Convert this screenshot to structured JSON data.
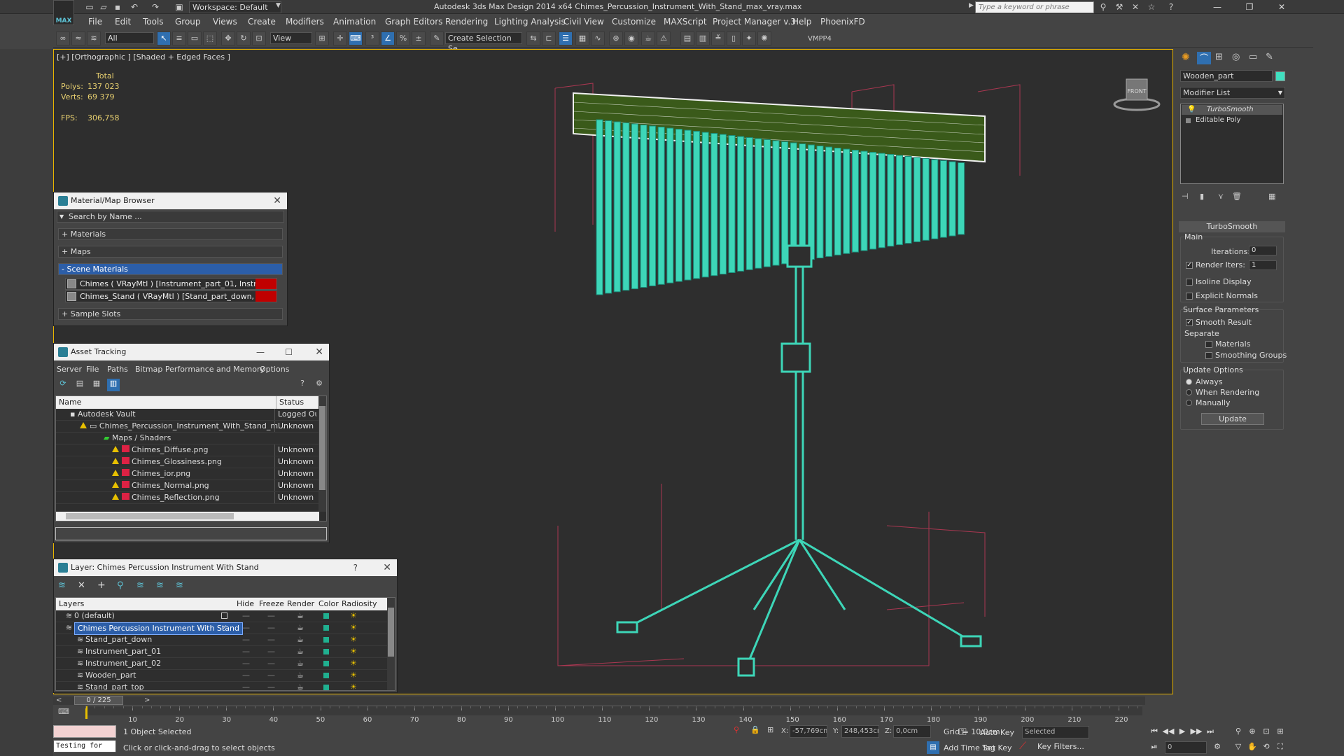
{
  "window": {
    "title": "Autodesk 3ds Max Design 2014 x64     Chimes_Percussion_Instrument_With_Stand_max_vray.max",
    "workspace": "Workspace: Default",
    "search_placeholder": "Type a keyword or phrase",
    "logo": "MAX"
  },
  "menu": [
    "File",
    "Edit",
    "Tools",
    "Group",
    "Views",
    "Create",
    "Modifiers",
    "Animation",
    "Graph Editors",
    "Rendering",
    "Lighting Analysis",
    "Civil View",
    "Customize",
    "MAXScript",
    "Project Manager v.3",
    "Help",
    "PhoenixFD"
  ],
  "toolbar": {
    "selection_filter": "All",
    "ref_coord": "View",
    "named_selection": "Create Selection Se",
    "vmpp": "VMPP4"
  },
  "viewport": {
    "label": "[+] [Orthographic ] [Shaded + Edged Faces ]",
    "stats": {
      "total_label": "Total",
      "polys_label": "Polys:",
      "polys": "137 023",
      "verts_label": "Verts:",
      "verts": "69 379",
      "fps_label": "FPS:",
      "fps": "306,758"
    },
    "viewcube_label": "FRONT"
  },
  "material_browser": {
    "title": "Material/Map Browser",
    "search_placeholder": "Search by Name ...",
    "groups": [
      "+ Materials",
      "+ Maps",
      "- Scene Materials",
      "+ Sample Slots"
    ],
    "materials": [
      "Chimes  ( VRayMtl )  [Instrument_part_01, Instrument_par...",
      "Chimes_Stand  ( VRayMtl ) [Stand_part_down, Stand_part..."
    ]
  },
  "asset_tracking": {
    "title": "Asset Tracking",
    "menu": [
      "Server",
      "File",
      "Paths",
      "Bitmap Performance and Memory",
      "Options"
    ],
    "col_name": "Name",
    "col_status": "Status",
    "rows": [
      {
        "name": "Autodesk Vault",
        "status": "Logged Out"
      },
      {
        "name": "Chimes_Percussion_Instrument_With_Stand_m...",
        "status": "Unknown St"
      },
      {
        "name": "Maps / Shaders",
        "status": ""
      },
      {
        "name": "Chimes_Diffuse.png",
        "status": "Unknown St"
      },
      {
        "name": "Chimes_Glossiness.png",
        "status": "Unknown St"
      },
      {
        "name": "Chimes_ior.png",
        "status": "Unknown St"
      },
      {
        "name": "Chimes_Normal.png",
        "status": "Unknown St"
      },
      {
        "name": "Chimes_Reflection.png",
        "status": "Unknown St"
      }
    ]
  },
  "layer_manager": {
    "title": "Layer: Chimes Percussion Instrument With Stand",
    "help": "?",
    "columns": [
      "Layers",
      "Hide",
      "Freeze",
      "Render",
      "Color",
      "Radiosity"
    ],
    "rows": [
      {
        "name": "0 (default)",
        "color": "#20b090"
      },
      {
        "name": "Chimes Percussion Instrument With Stand",
        "color": "#20b090"
      },
      {
        "name": "Stand_part_down",
        "color": "#20b090"
      },
      {
        "name": "Instrument_part_01",
        "color": "#20b090"
      },
      {
        "name": "Instrument_part_02",
        "color": "#20b090"
      },
      {
        "name": "Wooden_part",
        "color": "#20b090"
      },
      {
        "name": "Stand_part_top",
        "color": "#20b090"
      }
    ]
  },
  "command_panel": {
    "object_name": "Wooden_part",
    "object_color": "#40e0c0",
    "modifier_list": "Modifier List",
    "stack": [
      "TurboSmooth",
      "Editable Poly"
    ],
    "turbosmooth": {
      "title": "TurboSmooth",
      "main": "Main",
      "iterations_label": "Iterations:",
      "iterations": "0",
      "render_iters_label": "Render Iters:",
      "render_iters": "1",
      "isoline": "Isoline Display",
      "explicit": "Explicit Normals",
      "surface": "Surface Parameters",
      "smooth_result": "Smooth Result",
      "separate": "Separate",
      "materials": "Materials",
      "smoothing_groups": "Smoothing Groups",
      "update_options": "Update Options",
      "always": "Always",
      "when_rendering": "When Rendering",
      "manually": "Manually",
      "update": "Update"
    }
  },
  "timeline": {
    "frame": "0 / 225",
    "ticks": [
      "10",
      "20",
      "30",
      "40",
      "50",
      "60",
      "70",
      "80",
      "90",
      "100",
      "110",
      "120",
      "130",
      "140",
      "150",
      "160",
      "170",
      "180",
      "190",
      "200",
      "210",
      "220"
    ]
  },
  "status": {
    "maxscript": "Testing for",
    "selected": "1 Object Selected",
    "prompt": "Click or click-and-drag to select objects",
    "x_label": "X:",
    "x": "-57,769cm",
    "y_label": "Y:",
    "y": "248,453cm",
    "z_label": "Z:",
    "z": "0,0cm",
    "grid": "Grid = 10,0cm",
    "add_time_tag": "Add Time Tag",
    "auto_key": "Auto Key",
    "set_key": "Set Key",
    "selected_set": "Selected",
    "key_filters": "Key Filters...",
    "frame_field": "0"
  }
}
